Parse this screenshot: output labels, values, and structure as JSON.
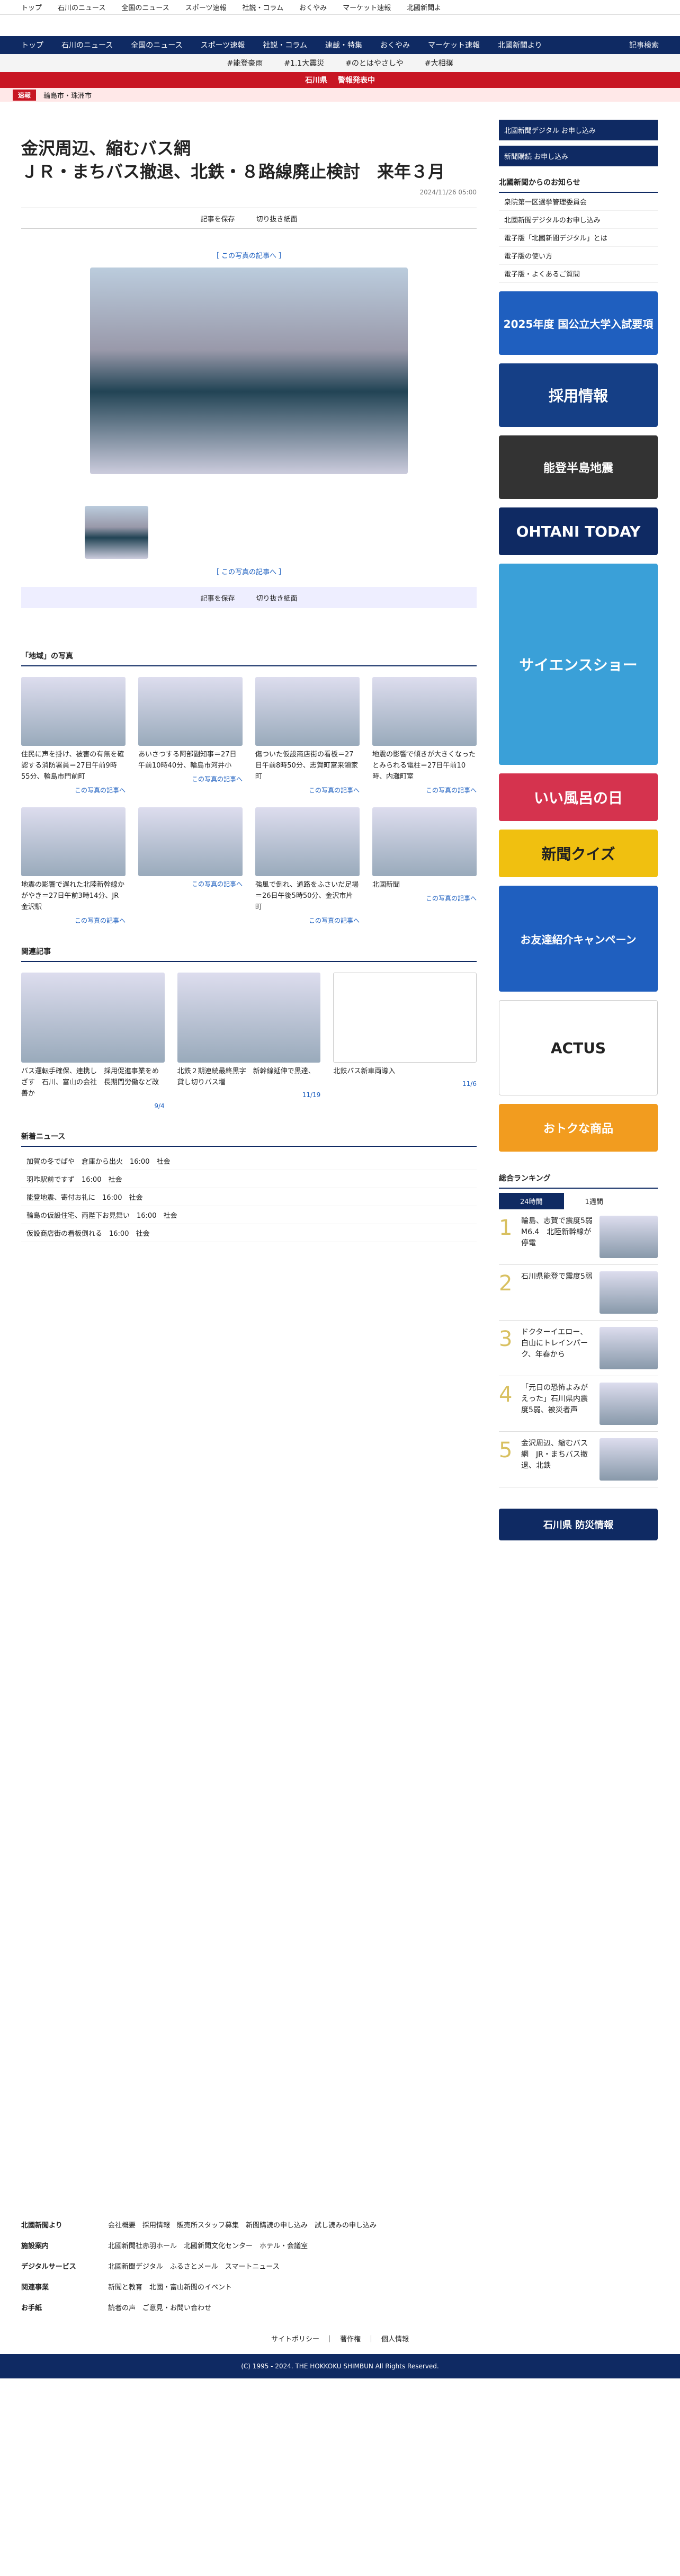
{
  "topnav": [
    "トップ",
    "石川のニュース",
    "全国のニュース",
    "スポーツ速報",
    "社説・コラム",
    "おくやみ",
    "マーケット速報",
    "北國新聞よ"
  ],
  "nav": {
    "items": [
      "トップ",
      "石川のニュース",
      "全国のニュース",
      "スポーツ速報",
      "社説・コラム",
      "連載・特集",
      "おくやみ",
      "マーケット速報",
      "北國新聞より"
    ],
    "member": "記事検索"
  },
  "topics": [
    "#能登豪雨",
    "#1.1大震災",
    "#のとはやさしや",
    "#大相撲"
  ],
  "alert": {
    "pref": "石川県",
    "text": "警報発表中"
  },
  "breaking": {
    "tag": "速報",
    "text": "輪島市・珠洲市"
  },
  "article": {
    "title_l1": "金沢周辺、縮むバス網",
    "title_l2": "ＪＲ・まちバス撤退、北鉄・８路線廃止検討　来年３月",
    "date": "2024/11/26 05:00",
    "save": "記事を保存",
    "share": "切り抜き紙面",
    "photo_link": "［ この写真の記事へ ］"
  },
  "region": {
    "head": "「地域」の写真",
    "more": "この写真の記事へ",
    "items": [
      "住民に声を掛け、被害の有無を確認する消防署員＝27日午前9時55分、輪島市門前町",
      "あいさつする阿部副知事＝27日午前10時40分、輪島市河井小",
      "傷ついた仮設商店街の看板＝27日午前8時50分、志賀町富来領家町",
      "地震の影響で傾きが大きくなったとみられる電柱＝27日午前10時、内灘町室",
      "地震の影響で遅れた北陸新幹線かがやき＝27日午前3時14分、JR金沢駅",
      "",
      "強風で倒れ、道路をふさいだ足場＝26日午後5時50分、金沢市片町",
      "北國新聞"
    ]
  },
  "related": {
    "head": "関連記事",
    "items": [
      {
        "t": "バス運転手確保、連携し　採用促進事業をめざす　石川、富山の会社　長期間労働など改善か",
        "d": "9/4"
      },
      {
        "t": "北鉄２期連続最終黒字　新幹線延伸で黒達、貸し切りバス増",
        "d": "11/19"
      },
      {
        "t": "北鉄バス新車両導入",
        "d": "11/6"
      }
    ]
  },
  "newsflash": {
    "head": "新着ニュース",
    "items": [
      "加賀の冬でばや　倉庫から出火　16:00　社会",
      "羽咋駅前ですず　16:00　社会",
      "能登地震、寄付お礼に　16:00　社会",
      "輪島の仮設住宅、両陛下お見舞い　16:00　社会",
      "仮設商店街の看板倒れる　16:00　社会"
    ]
  },
  "ranking": {
    "head": "総合ランキング",
    "tabs": [
      "24時間",
      "1週間"
    ],
    "items": [
      "輪島、志賀で震度5弱　M6.4　北陸新幹線が停電",
      "石川県能登で震度5弱",
      "ドクターイエロー、白山にトレインパーク、年春から",
      "「元日の恐怖よみがえった」石川県内震度5弱、被災者声",
      "金沢周辺、縮むバス網　JR・まちバス撤退、北鉄"
    ]
  },
  "side": {
    "links": [
      "北國新聞デジタル お申し込み",
      "新聞購読 お申し込み"
    ],
    "more_head": "北國新聞からのお知らせ",
    "more": [
      "衆院第一区選挙管理委員会",
      "北國新聞デジタルのお申し込み",
      "電子版「北國新聞デジタル」とは",
      "電子版の使い方",
      "電子版・よくあるご質問"
    ],
    "ads": [
      "2025年度 国公立大学入試要項",
      "採用情報",
      "能登半島地震",
      "OHTANI TODAY",
      "サイエンスショー",
      "いい風呂の日",
      "新聞クイズ",
      "お友達紹介キャンペーン",
      "ACTUS",
      "おトクな商品"
    ],
    "bosai": "石川県 防災情報"
  },
  "footer": {
    "rows": [
      {
        "h": "北國新聞より",
        "v": "会社概要　採用情報　販売所スタッフ募集　新聞購読の申し込み　試し読みの申し込み"
      },
      {
        "h": "施設案内",
        "v": "北國新聞社赤羽ホール　北國新聞文化センター　ホテル・会議室"
      },
      {
        "h": "デジタルサービス",
        "v": "北國新聞デジタル　ふるさとメール　スマートニュース"
      },
      {
        "h": "関連事業",
        "v": "新聞と教育　北國・富山新聞のイベント"
      },
      {
        "h": "お手紙",
        "v": "読者の声　ご意見・お問い合わせ"
      }
    ],
    "privacy": "サイトポリシー　｜　著作権　｜　個人情報",
    "copy": "(C) 1995 - 2024. THE HOKKOKU SHIMBUN All Rights Reserved."
  },
  "colors": {
    "navy": "#0f2a63",
    "red": "#c81623"
  }
}
